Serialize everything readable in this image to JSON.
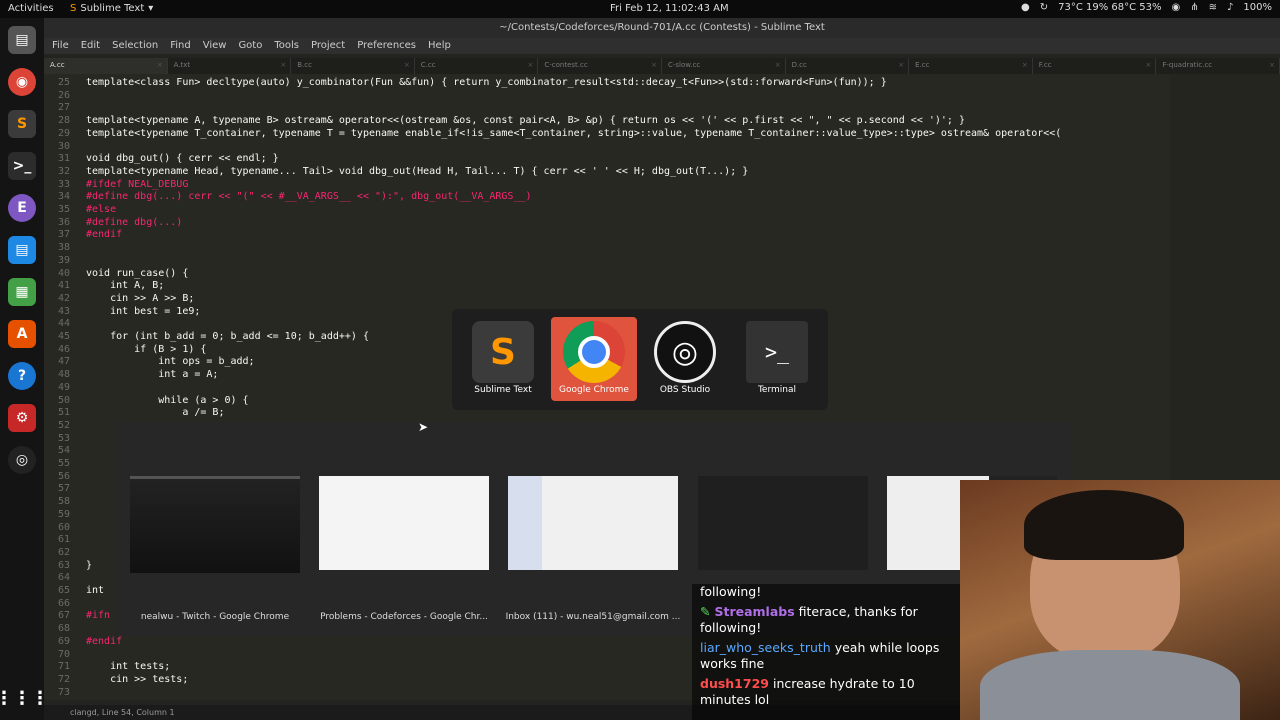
{
  "topbar": {
    "activities": "Activities",
    "app_name": "Sublime Text",
    "clock": "Fri Feb 12, 11:02:43 AM",
    "sensors": "73°C 19% 68°C 53%",
    "battery": "100%"
  },
  "window": {
    "title": "~/Contests/Codeforces/Round-701/A.cc (Contests) - Sublime Text"
  },
  "menu": [
    "File",
    "Edit",
    "Selection",
    "Find",
    "View",
    "Goto",
    "Tools",
    "Project",
    "Preferences",
    "Help"
  ],
  "tabs": [
    "A.cc",
    "A.txt",
    "B.cc",
    "C.cc",
    "C-contest.cc",
    "C-slow.cc",
    "D.cc",
    "E.cc",
    "F.cc",
    "F-quadratic.cc"
  ],
  "code": [
    {
      "n": "25",
      "t": "template<class Fun> decltype(auto) y_combinator(Fun &&fun) { return y_combinator_result<std::decay_t<Fun>>(std::forward<Fun>(fun)); }"
    },
    {
      "n": "26",
      "t": ""
    },
    {
      "n": "27",
      "t": ""
    },
    {
      "n": "28",
      "t": "template<typename A, typename B> ostream& operator<<(ostream &os, const pair<A, B> &p) { return os << '(' << p.first << \", \" << p.second << ')'; }"
    },
    {
      "n": "29",
      "t": "template<typename T_container, typename T = typename enable_if<!is_same<T_container, string>::value, typename T_container::value_type>::type> ostream& operator<<("
    },
    {
      "n": "30",
      "t": ""
    },
    {
      "n": "31",
      "t": "void dbg_out() { cerr << endl; }"
    },
    {
      "n": "32",
      "t": "template<typename Head, typename... Tail> void dbg_out(Head H, Tail... T) { cerr << ' ' << H; dbg_out(T...); }"
    },
    {
      "n": "33",
      "t": "#ifdef NEAL_DEBUG"
    },
    {
      "n": "34",
      "t": "#define dbg(...) cerr << \"(\" << #__VA_ARGS__ << \"):\", dbg_out(__VA_ARGS__)"
    },
    {
      "n": "35",
      "t": "#else"
    },
    {
      "n": "36",
      "t": "#define dbg(...)"
    },
    {
      "n": "37",
      "t": "#endif"
    },
    {
      "n": "38",
      "t": ""
    },
    {
      "n": "39",
      "t": ""
    },
    {
      "n": "40",
      "t": "void run_case() {"
    },
    {
      "n": "41",
      "t": "    int A, B;"
    },
    {
      "n": "42",
      "t": "    cin >> A >> B;"
    },
    {
      "n": "43",
      "t": "    int best = 1e9;"
    },
    {
      "n": "44",
      "t": ""
    },
    {
      "n": "45",
      "t": "    for (int b_add = 0; b_add <= 10; b_add++) {"
    },
    {
      "n": "46",
      "t": "        if (B > 1) {"
    },
    {
      "n": "47",
      "t": "            int ops = b_add;"
    },
    {
      "n": "48",
      "t": "            int a = A;"
    },
    {
      "n": "49",
      "t": ""
    },
    {
      "n": "50",
      "t": "            while (a > 0) {"
    },
    {
      "n": "51",
      "t": "                a /= B;"
    },
    {
      "n": "52",
      "t": ""
    },
    {
      "n": "53",
      "t": ""
    },
    {
      "n": "54",
      "t": ""
    },
    {
      "n": "55",
      "t": ""
    },
    {
      "n": "56",
      "t": ""
    },
    {
      "n": "57",
      "t": ""
    },
    {
      "n": "58",
      "t": ""
    },
    {
      "n": "59",
      "t": ""
    },
    {
      "n": "60",
      "t": ""
    },
    {
      "n": "61",
      "t": ""
    },
    {
      "n": "62",
      "t": ""
    },
    {
      "n": "63",
      "t": "}"
    },
    {
      "n": "64",
      "t": ""
    },
    {
      "n": "65",
      "t": "int"
    },
    {
      "n": "66",
      "t": ""
    },
    {
      "n": "67",
      "t": "#ifn"
    },
    {
      "n": "68",
      "t": ""
    },
    {
      "n": "69",
      "t": "#endif"
    },
    {
      "n": "70",
      "t": ""
    },
    {
      "n": "71",
      "t": "    int tests;"
    },
    {
      "n": "72",
      "t": "    cin >> tests;"
    },
    {
      "n": "73",
      "t": ""
    }
  ],
  "status": "clangd, Line 54, Column 1",
  "app_switcher": [
    {
      "label": "Sublime Text",
      "color": "#3b3b3b"
    },
    {
      "label": "Google Chrome",
      "color": "#e0533c"
    },
    {
      "label": "OBS Studio",
      "color": "#3b3b3b"
    },
    {
      "label": "Terminal",
      "color": "#3b3b3b"
    }
  ],
  "windows": [
    {
      "caption": "nealwu - Twitch - Google Chrome"
    },
    {
      "caption": "Problems - Codeforces - Google Chr..."
    },
    {
      "caption": "Inbox (111) - wu.neal51@gmail.com ..."
    },
    {
      "caption": ""
    },
    {
      "caption": ""
    }
  ],
  "chat": [
    {
      "user": "",
      "text": "following!"
    },
    {
      "user": "Streamlabs",
      "text": "fiterace, thanks for following!"
    },
    {
      "user": "liar_who_seeks_truth",
      "text": "yeah while loops works fine"
    },
    {
      "user": "dush1729",
      "text": "increase hydrate to 10 minutes lol"
    }
  ]
}
